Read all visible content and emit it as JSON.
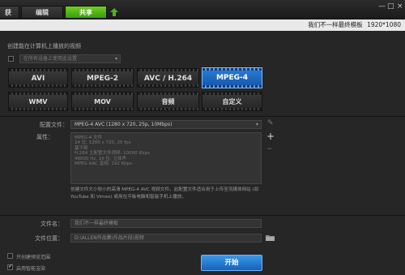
{
  "tabs": [
    {
      "label": "获"
    },
    {
      "label": "编辑"
    },
    {
      "label": "共享"
    }
  ],
  "window_controls": {
    "minimize": "—",
    "maximize": "□",
    "close": "×"
  },
  "info_bar": {
    "project_title": "我们不一样最终模板",
    "resolution": "1920*1080"
  },
  "section": {
    "title": "创建能在计算机上播放的视频"
  },
  "device_dropdown": {
    "value": "在所有设备上使用此设置"
  },
  "formats": [
    {
      "label": "AVI"
    },
    {
      "label": "MPEG-2"
    },
    {
      "label": "AVC / H.264"
    },
    {
      "label": "MPEG-4",
      "selected": true
    },
    {
      "label": "WMV"
    },
    {
      "label": "MOV"
    },
    {
      "label": "音频"
    },
    {
      "label": "自定义"
    }
  ],
  "profile": {
    "label": "配置文件：",
    "value": "MPEG-4 AVC (1280 x 720, 25p, 10Mbps)"
  },
  "properties": {
    "label": "属性：",
    "lines": [
      "MPEG-4 文件",
      "24 位, 1280 x 720, 25 fps",
      "基于帧",
      "H.264 主配置文件视频: 10000 Kbps",
      "48000 Hz, 16 位, 立体声",
      "MPEG AAC 音频: 192 Kbps"
    ]
  },
  "description": "创建文件大小较小的高清 MPEG-4 AVC 视频文件。此配置文件适合用于上传至流媒体网站 (如 YouTube 和 Vimeo) 或用在平板电脑和智能手机上播放。",
  "file_name": {
    "label": "文件名：",
    "value": "我们不一样最终模板"
  },
  "file_location": {
    "label": "文件位置：",
    "value": "D:\\ALLEN作品集\\作品片段\\视频"
  },
  "options": [
    {
      "label": "只创建预览范围",
      "checked": false
    },
    {
      "label": "启用智能渲染",
      "checked": true
    }
  ],
  "start_button": {
    "label": "开始"
  },
  "colors": {
    "accent_green": "#4db417",
    "selected_blue": "#2a7ed6",
    "start_blue": "#2a7ed6"
  },
  "icons": [
    "upload-arrow-icon",
    "edit-pencil-icon",
    "add-plus-icon",
    "remove-minus-icon",
    "folder-icon"
  ]
}
